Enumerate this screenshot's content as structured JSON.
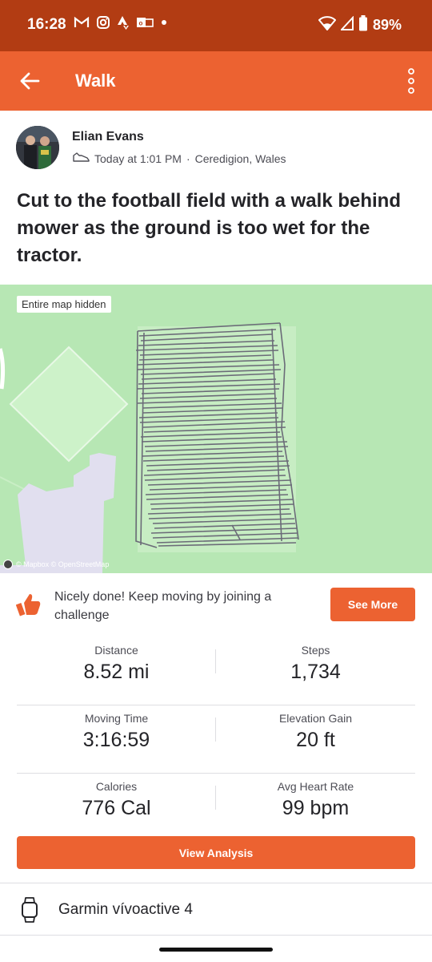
{
  "status_bar": {
    "time": "16:28",
    "battery": "89%",
    "icons": [
      "gmail-icon",
      "instagram-icon",
      "strava-icon",
      "outlook-icon",
      "dot-icon",
      "wifi-icon",
      "signal-icon",
      "battery-icon"
    ]
  },
  "app_bar": {
    "title": "Walk",
    "back_icon": "arrow-left-icon",
    "menu_icon": "more-vertical-icon"
  },
  "athlete": {
    "name": "Elian Evans",
    "time": "Today at 1:01 PM",
    "separator": "·",
    "location": "Ceredigion, Wales",
    "activity_icon": "shoe-icon"
  },
  "activity": {
    "title": "Cut to the football field with a walk behind mower as the ground is too wet for the tractor."
  },
  "map": {
    "badge": "Entire map hidden",
    "attribution": "© Mapbox © OpenStreetMap",
    "track_color": "#6b6b78"
  },
  "challenge": {
    "text": "Nicely done! Keep moving by joining a challenge",
    "button": "See More",
    "icon": "thumbs-up-icon"
  },
  "stats": [
    {
      "left_label": "Distance",
      "left_value": "8.52 mi",
      "right_label": "Steps",
      "right_value": "1,734"
    },
    {
      "left_label": "Moving Time",
      "left_value": "3:16:59",
      "right_label": "Elevation Gain",
      "right_value": "20 ft"
    },
    {
      "left_label": "Calories",
      "left_value": "776 Cal",
      "right_label": "Avg Heart Rate",
      "right_value": "99 bpm"
    }
  ],
  "view_analysis": "View Analysis",
  "device": {
    "name": "Garmin vívoactive 4",
    "icon": "watch-icon"
  },
  "colors": {
    "accent": "#ec6231",
    "status_bar": "#b23c13",
    "map_green": "#b7e7b4"
  }
}
